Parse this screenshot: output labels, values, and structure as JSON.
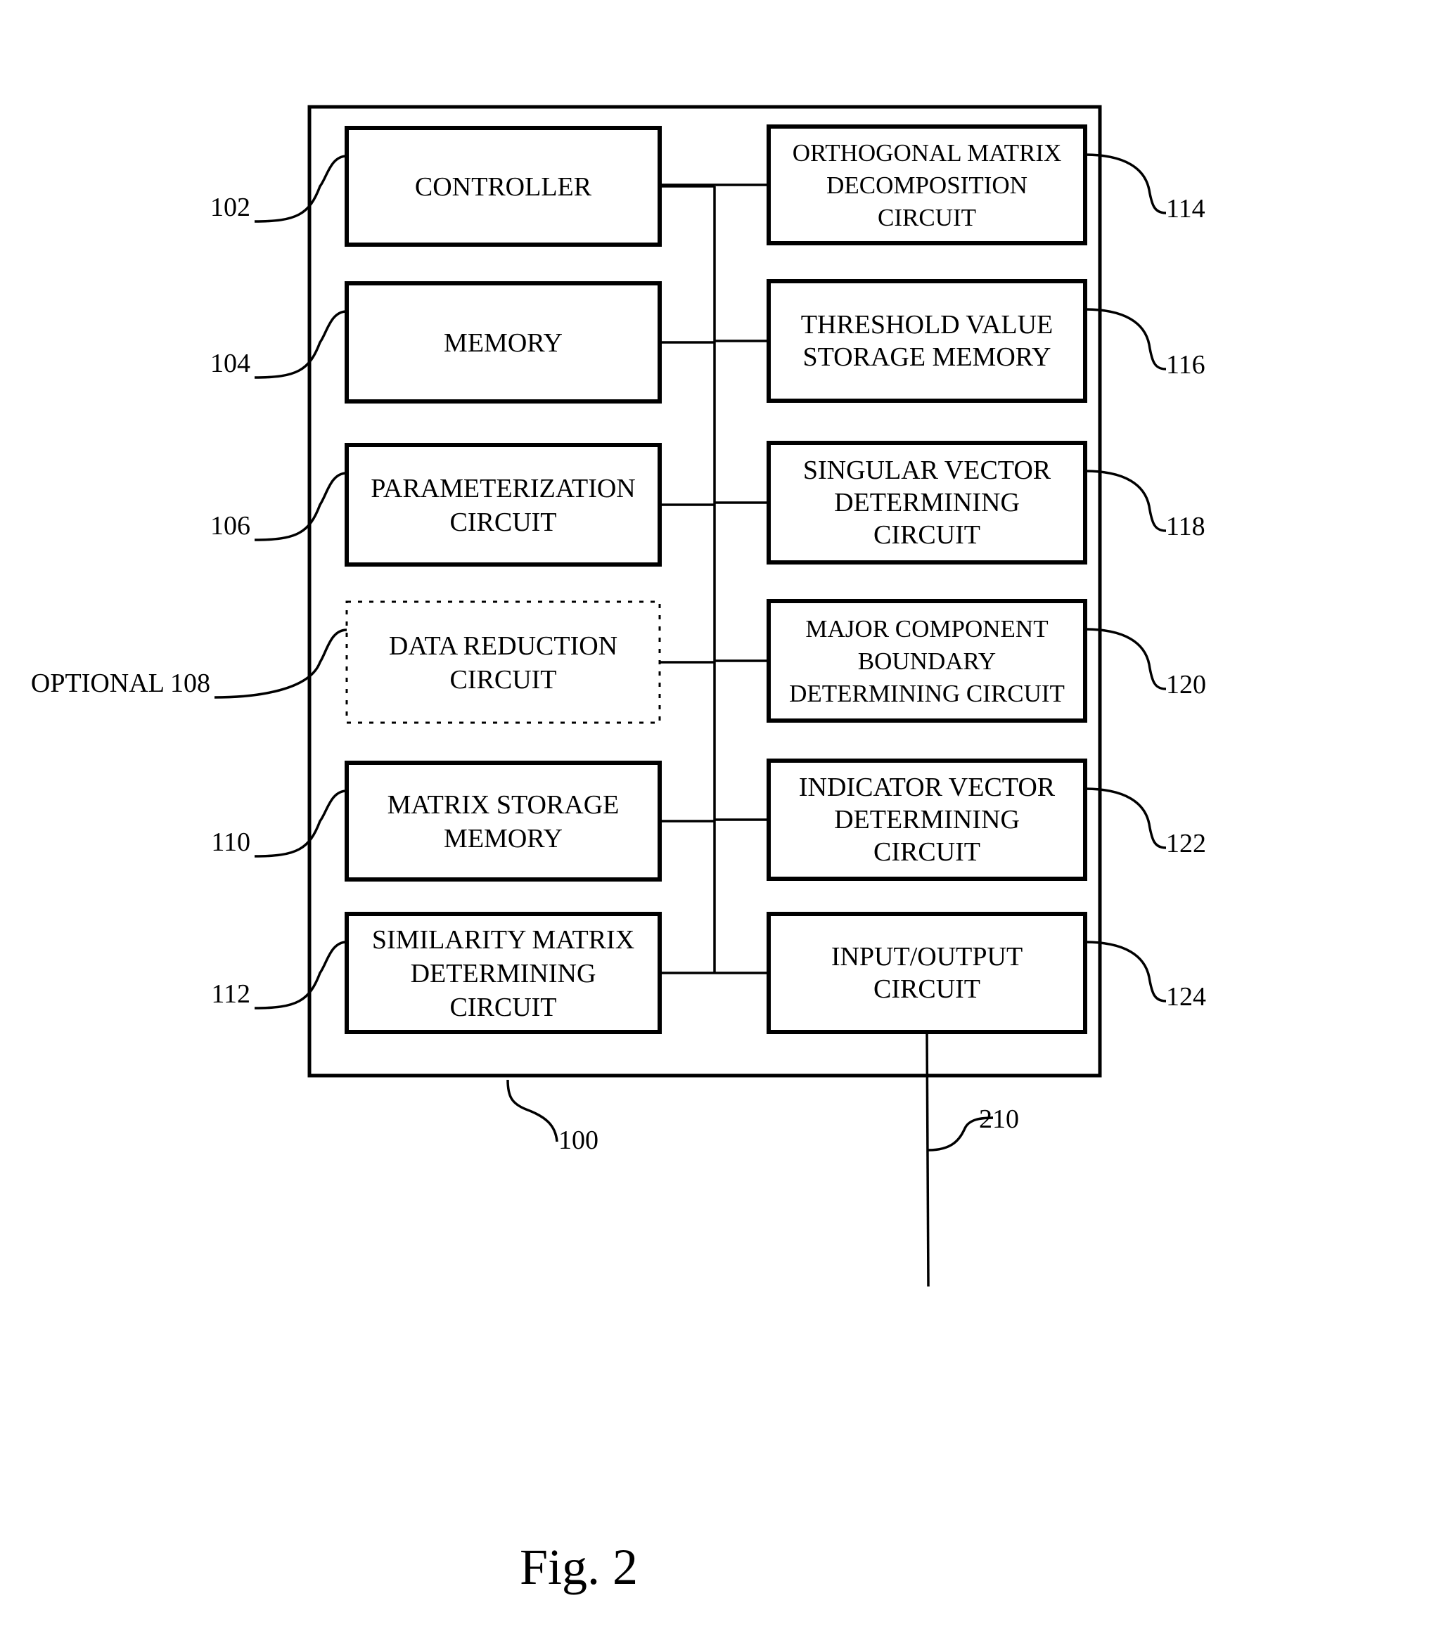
{
  "figure": {
    "caption": "Fig. 2",
    "system_ref": "100",
    "bus_ref": "210"
  },
  "left_blocks": [
    {
      "ref": "102",
      "lines": [
        "CONTROLLER"
      ],
      "optional": false
    },
    {
      "ref": "104",
      "lines": [
        "MEMORY"
      ],
      "optional": false
    },
    {
      "ref": "106",
      "lines": [
        "PARAMETERIZATION",
        "CIRCUIT"
      ],
      "optional": false
    },
    {
      "ref": "OPTIONAL 108",
      "lines": [
        "DATA REDUCTION",
        "CIRCUIT"
      ],
      "optional": true
    },
    {
      "ref": "110",
      "lines": [
        "MATRIX STORAGE",
        "MEMORY"
      ],
      "optional": false
    },
    {
      "ref": "112",
      "lines": [
        "SIMILARITY MATRIX",
        "DETERMINING",
        "CIRCUIT"
      ],
      "optional": false
    }
  ],
  "right_blocks": [
    {
      "ref": "114",
      "lines": [
        "ORTHOGONAL MATRIX",
        "DECOMPOSITION",
        "CIRCUIT"
      ]
    },
    {
      "ref": "116",
      "lines": [
        "THRESHOLD VALUE",
        "STORAGE MEMORY"
      ]
    },
    {
      "ref": "118",
      "lines": [
        "SINGULAR VECTOR",
        "DETERMINING",
        "CIRCUIT"
      ]
    },
    {
      "ref": "120",
      "lines": [
        "MAJOR COMPONENT",
        "BOUNDARY",
        "DETERMINING CIRCUIT"
      ]
    },
    {
      "ref": "122",
      "lines": [
        "INDICATOR VECTOR",
        "DETERMINING",
        "CIRCUIT"
      ]
    },
    {
      "ref": "124",
      "lines": [
        "INPUT/OUTPUT",
        "CIRCUIT"
      ]
    }
  ]
}
